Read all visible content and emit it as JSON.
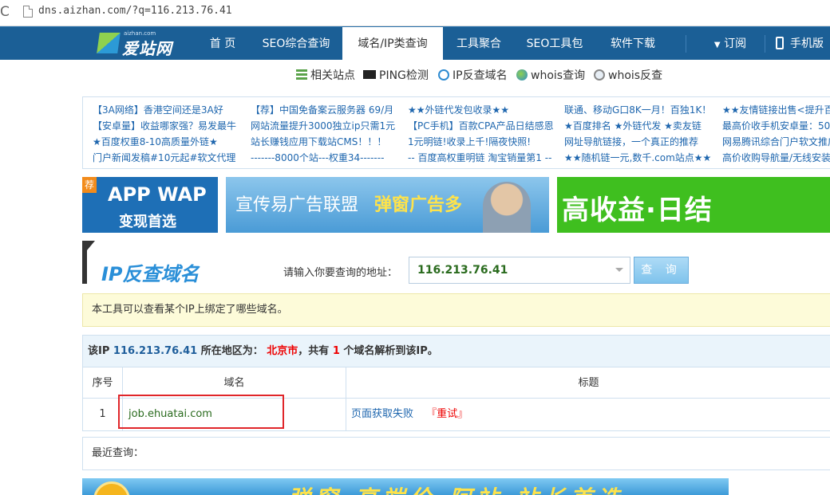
{
  "address_bar": {
    "url": "dns.aizhan.com/?q=116.213.76.41"
  },
  "site": {
    "logo_text": "爱站网",
    "logo_sub": "aizhan.com"
  },
  "nav": {
    "items": [
      "首 页",
      "SEO综合查询",
      "域名/IP类查询",
      "工具聚合",
      "SEO工具包",
      "软件下载"
    ],
    "active": "域名/IP类查询",
    "subscribe": "订阅",
    "mobile": "手机版"
  },
  "subnav": [
    "相关站点",
    "PING检测",
    "IP反查域名",
    "whois查询",
    "whois反查"
  ],
  "ads": {
    "col1": [
      "【3A网络】香港空间还是3A好",
      "【安卓量】收益哪家强？易发最牛",
      "★百度权重8-10高质量外链★",
      "门户新闻发稿#10元起#软文代理"
    ],
    "col2": [
      "【荐】中国免备案云服务器 69/月",
      "网站流量提升3000独立ip只需1元",
      "站长赚钱应用下载站CMS！！！",
      "-------8000个站---权重34-------"
    ],
    "col3": [
      "★★外链代发包收录★★",
      "【PC手机】百款CPA产品日结感恩",
      "1元明链!收录上千!隔夜快照!",
      "-- 百度高权重明链 淘宝销量第1 --"
    ],
    "col4": [
      "联通、移动G口8K一月！百独1K！",
      "★百度排名 ★外链代发 ★卖友链",
      "网址导航链接，一个真正的推荐",
      "★★随机链一元,数千.com站点★★"
    ],
    "col5": [
      "★★友情链接出售<提升百",
      "最高价收手机安卓量：50",
      "网易腾讯综合门户软文推广",
      "高价收购导航量/无线安装"
    ]
  },
  "banners": {
    "b1_tag": "荐",
    "b1_line1": "APP WAP",
    "b1_line2": "变现首选",
    "b2_text": "宣传易广告联盟",
    "b2_highlight": "弹窗广告多",
    "b3_text": "高收益·日结",
    "b4_text": "弹窗 高端价 阿站 站长首选"
  },
  "tool": {
    "title": "IP反查域名",
    "query_label": "请输入你要查询的地址：",
    "query_value": "116.213.76.41",
    "button": "查 询",
    "notice": "本工具可以查看某个IP上绑定了哪些域名。"
  },
  "result": {
    "prefix": "该IP",
    "ip": "116.213.76.41",
    "region_label": "所在地区为：",
    "region": "北京市",
    "count_prefix": "，共有",
    "count": "1",
    "count_suffix": "个域名解析到该IP。",
    "headers": [
      "序号",
      "域名",
      "标题"
    ],
    "rows": [
      {
        "index": "1",
        "domain": "job.ehuatai.com",
        "title": "页面获取失败",
        "retry": "『重试』"
      }
    ]
  },
  "recent": {
    "label": "最近查询："
  },
  "colors": {
    "nav_bg": "#1b5f96",
    "link": "#1e66ae",
    "highlight_box": "#e0262a"
  }
}
